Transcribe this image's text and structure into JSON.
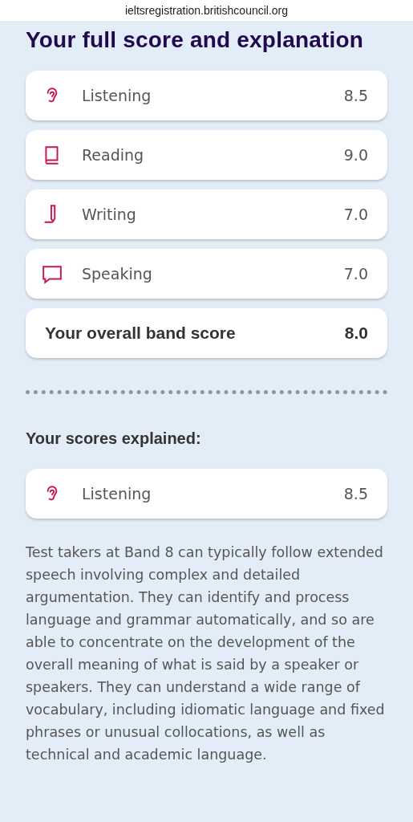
{
  "address_bar": {
    "url": "ieltsregistration.britishcouncil.org"
  },
  "title": "Your full score and explanation",
  "scores": [
    {
      "kind": "ear",
      "label": "Listening",
      "score": "8.5"
    },
    {
      "kind": "book",
      "label": "Reading",
      "score": "9.0"
    },
    {
      "kind": "pen",
      "label": "Writing",
      "score": "7.0"
    },
    {
      "kind": "speech",
      "label": "Speaking",
      "score": "7.0"
    }
  ],
  "overall": {
    "label": "Your overall band score",
    "score": "8.0"
  },
  "explained": {
    "heading": "Your scores explained:",
    "card": {
      "kind": "ear",
      "label": "Listening",
      "score": "8.5"
    },
    "text": "Test takers at Band 8 can typically follow extended speech involving complex and detailed argumentation. They can identify and process language and grammar automatically, and so are able to concentrate on the development of the overall meaning of what is said by a speaker or speakers. They can understand a wide range of vocabulary, including idiomatic language and fixed phrases or unusual collocations, as well as technical and academic language."
  }
}
